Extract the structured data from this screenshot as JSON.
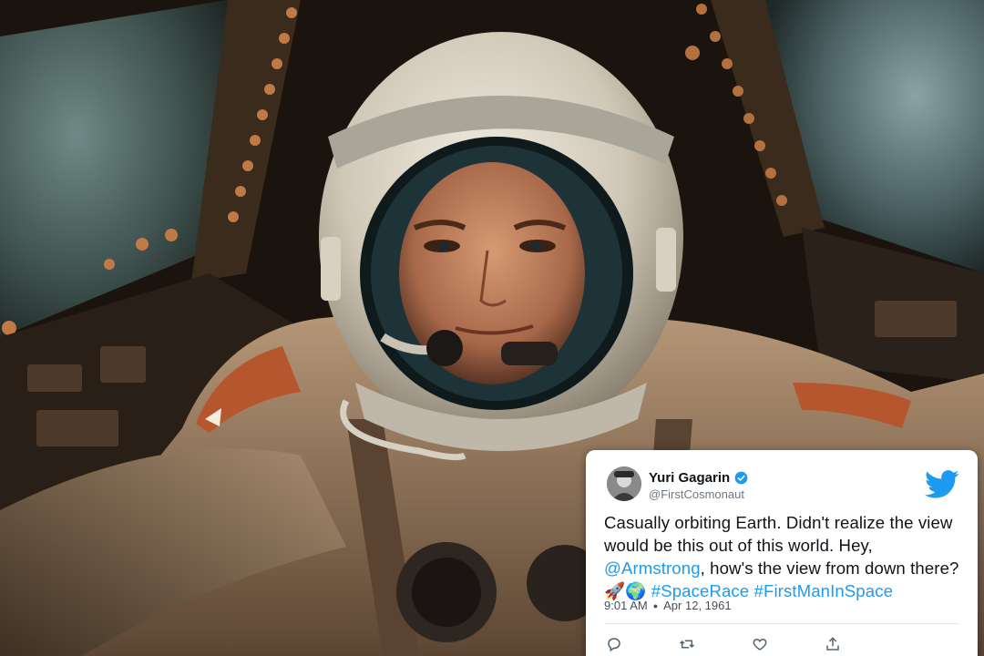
{
  "tweet": {
    "author_name": "Yuri Gagarin",
    "handle": "@FirstCosmonaut",
    "text_part1": "Casually orbiting Earth. Didn't realize the view would be this out of this world. Hey, ",
    "mention": "@Armstrong",
    "text_part2": ", how's the view from down there? 🚀🌍 ",
    "hashtag1": "#SpaceRace",
    "hashtag2": "#FirstManInSpace",
    "time": "9:01 AM",
    "date": "Apr 12, 1961",
    "icons": {
      "avatar": "avatar-photo",
      "verified": "verified-badge-icon",
      "brand": "twitter-bird-icon",
      "reply": "reply-icon",
      "retweet": "retweet-icon",
      "like": "like-icon",
      "share": "share-icon"
    }
  },
  "colors": {
    "link": "#1d9bf0",
    "twitter_blue": "#1d9bf0",
    "card_bg": "#ffffff"
  }
}
